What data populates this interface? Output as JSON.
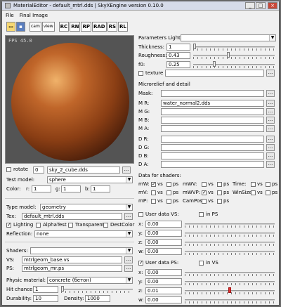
{
  "window": {
    "title": "MaterialEditor - default_mtrl.dds | SkyXEngine version 0.10.0"
  },
  "menu": [
    "File",
    "Final Image"
  ],
  "toolbar": {
    "open_icon": "folder-open-icon",
    "save_icon": "floppy-save-icon",
    "buttons": [
      "cam",
      "view",
      "RC",
      "RN",
      "RP",
      "RAD",
      "RS",
      "RL"
    ]
  },
  "viewport": {
    "fps": "FPS 45.0"
  },
  "rotate": {
    "label": "rotate",
    "value": "0"
  },
  "skybox": "sky_2_cube.dds",
  "test_model": {
    "label": "Test model:",
    "value": "sphere"
  },
  "color": {
    "label": "Color:",
    "r_label": "r:",
    "r": "1",
    "g_label": "g:",
    "g": "1",
    "b_label": "b:",
    "b": "1"
  },
  "type_model": {
    "label": "Type model:",
    "value": "geometry"
  },
  "tex": {
    "label": "Tex:",
    "value": "default_mtrl.dds"
  },
  "flags": {
    "lighting": "Lighting",
    "alphatest": "AlphaTest",
    "transparent": "Transparent",
    "destcolor": "DestColor"
  },
  "reflection": {
    "label": "Reflection:",
    "value": "none"
  },
  "shaders": {
    "label": "Shaders:",
    "vs_label": "VS:",
    "vs": "mtrlgeom_base.vs",
    "ps_label": "PS:",
    "ps": "mtrlgeom_mr.ps"
  },
  "physic": {
    "label": "Physic material:",
    "value": "concrete (бетон)"
  },
  "hit_chance": {
    "label": "Hit chance:",
    "value": "1"
  },
  "durability": {
    "label": "Durability:",
    "value": "10",
    "density_label": "Density:",
    "density": "1000"
  },
  "lighting_params": {
    "title": "Parameters Lighting:",
    "thickness_label": "Thickness:",
    "thickness": "1",
    "roughness_label": "Roughness:",
    "roughness": "0.43",
    "f0_label": "f0:",
    "f0": "0.25",
    "texture_label": "texture"
  },
  "microrelief": {
    "title": "Microrelief and detail",
    "mask_label": "Mask:",
    "mr_label": "M R:",
    "mr": "water_normal2.dds",
    "mg_label": "M G:",
    "mb_label": "M B:",
    "ma_label": "M A:",
    "dr_label": "D R:",
    "dg_label": "D G:",
    "db_label": "D B:",
    "da_label": "D A:"
  },
  "shader_data": {
    "title": "Data for shaders:",
    "row1": [
      "mW:",
      "vs",
      "ps",
      "mWV:",
      "vs",
      "ps",
      "Time:",
      "vs",
      "ps"
    ],
    "row2": [
      "mV:",
      "vs",
      "ps",
      "mWVP:",
      "vs",
      "ps",
      "WinSize:",
      "vs",
      "ps"
    ],
    "row3": [
      "mP:",
      "vs",
      "ps",
      "CamPos:",
      "vs",
      "ps"
    ]
  },
  "user_vs": {
    "title": "User data VS:",
    "in_ps": "in PS",
    "x": "0.00",
    "y": "0.00",
    "z": "0.00",
    "w": "0.00"
  },
  "user_ps": {
    "title": "User data PS:",
    "in_vs": "in VS",
    "x": "0.00",
    "y": "0.00",
    "z": "0.01",
    "w": "0.00"
  },
  "axis": {
    "x": "x:",
    "y": "y:",
    "z": "z:",
    "w": "w:"
  },
  "sliders": {
    "thickness": 0.0,
    "roughness": 0.43,
    "f0": 0.25,
    "hit_chance": 0.0,
    "ps_z": 0.5
  }
}
